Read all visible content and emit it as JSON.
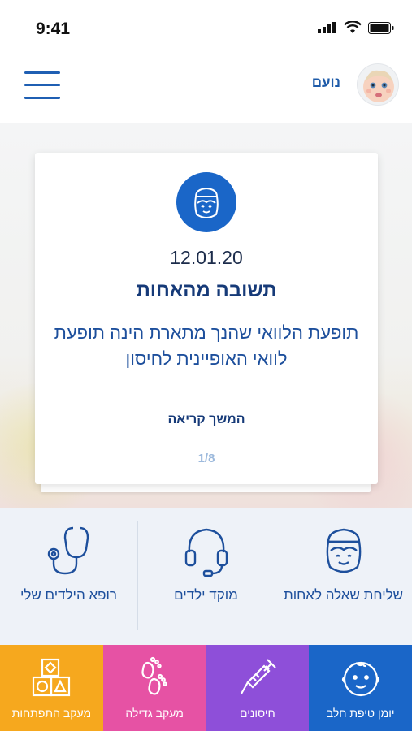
{
  "status": {
    "time": "9:41"
  },
  "header": {
    "user_name": "נועם"
  },
  "card": {
    "date": "12.01.20",
    "title": "תשובה מהאחות",
    "body": "תופעת הלוואי שהנך מתארת הינה תופעת לוואי האופיינית לחיסון",
    "read_more": "המשך קריאה",
    "pager": "1/8"
  },
  "services": [
    {
      "label": "שליחת שאלה לאחות",
      "icon": "nurse-icon"
    },
    {
      "label": "מוקד ילדים",
      "icon": "headset-icon"
    },
    {
      "label": "רופא הילדים שלי",
      "icon": "stethoscope-icon"
    }
  ],
  "bottom_nav": [
    {
      "label": "מעקב התפתחות",
      "icon": "blocks-icon",
      "color": "#f6a81e"
    },
    {
      "label": "מעקב גדילה",
      "icon": "footprints-icon",
      "color": "#e652a4"
    },
    {
      "label": "חיסונים",
      "icon": "syringe-icon",
      "color": "#8e4fd9"
    },
    {
      "label": "יומן טיפת חלב",
      "icon": "baby-face-icon",
      "color": "#1a66c8"
    }
  ]
}
